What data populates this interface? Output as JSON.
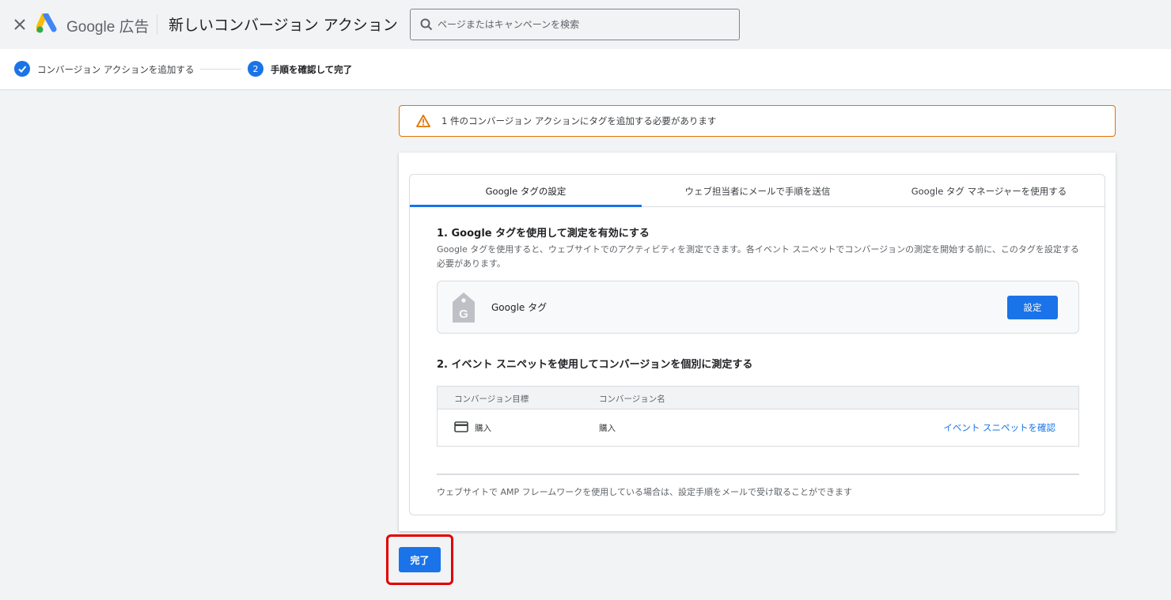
{
  "header": {
    "brand": "Google 広告",
    "title": "新しいコンバージョン アクション",
    "search_placeholder": "ページまたはキャンペーンを検索"
  },
  "stepper": {
    "step1_label": "コンバージョン アクションを追加する",
    "step2_number": "2",
    "step2_label": "手順を確認して完了"
  },
  "warning": {
    "text": "1 件のコンバージョン アクションにタグを追加する必要があります"
  },
  "tabs": [
    {
      "label": "Google タグの設定"
    },
    {
      "label": "ウェブ担当者にメールで手順を送信"
    },
    {
      "label": "Google タグ マネージャーを使用する"
    }
  ],
  "section1": {
    "heading": "1. Google タグを使用して測定を有効にする",
    "description": "Google タグを使用すると、ウェブサイトでのアクティビティを測定できます。各イベント スニペットでコンバージョンの測定を開始する前に、このタグを設定する必要があります。",
    "tag_label": "Google タグ",
    "setup_button": "設定"
  },
  "section2": {
    "heading": "2. イベント スニペットを使用してコンバージョンを個別に測定する",
    "columns": [
      "コンバージョン目標",
      "コンバージョン名"
    ],
    "rows": [
      {
        "goal": "購入",
        "name": "購入",
        "action": "イベント スニペットを確認"
      }
    ]
  },
  "amp_note": "ウェブサイトで AMP フレームワークを使用している場合は、設定手順をメールで受け取ることができます",
  "done_button": "完了",
  "colors": {
    "primary": "#1a73e8",
    "warning_border": "#e37400",
    "highlight": "#e00000"
  }
}
